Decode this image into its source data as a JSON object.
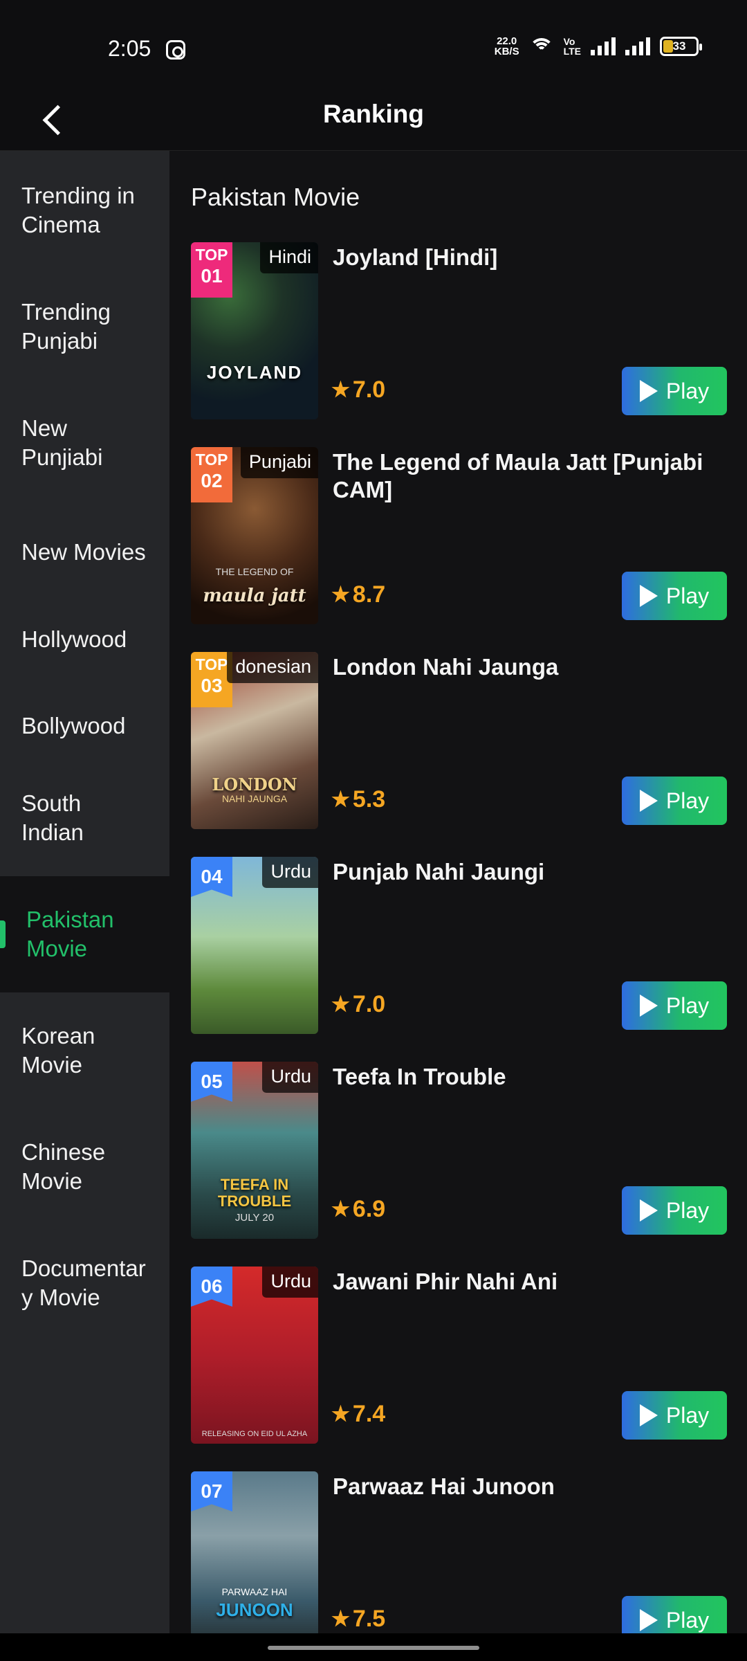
{
  "status_bar": {
    "time": "2:05",
    "net_speed_value": "22.0",
    "net_speed_unit": "KB/S",
    "volte_top": "Vo",
    "volte_bottom": "LTE",
    "battery": "33"
  },
  "header": {
    "title": "Ranking"
  },
  "sidebar": {
    "items": [
      {
        "label": "Trending in Cinema",
        "active": false
      },
      {
        "label": "Trending Punjabi",
        "active": false
      },
      {
        "label": "New Punjiabi",
        "active": false
      },
      {
        "label": "New Movies",
        "active": false
      },
      {
        "label": "Hollywood",
        "active": false
      },
      {
        "label": "Bollywood",
        "active": false
      },
      {
        "label": "South Indian",
        "active": false
      },
      {
        "label": "Pakistan Movie",
        "active": true
      },
      {
        "label": "Korean Movie",
        "active": false
      },
      {
        "label": "Chinese Movie",
        "active": false
      },
      {
        "label": "Documentary Movie",
        "active": false
      }
    ]
  },
  "content": {
    "section_title": "Pakistan Movie",
    "play_label": "Play",
    "movies": [
      {
        "rank_top": "TOP",
        "rank": "01",
        "language": "Hindi",
        "title": "Joyland [Hindi]",
        "rating": "7.0",
        "poster_text": "JOYLAND",
        "poster_sub": ""
      },
      {
        "rank_top": "TOP",
        "rank": "02",
        "language": "Punjabi",
        "title": "The Legend of Maula Jatt [Punjabi CAM]",
        "rating": "8.7",
        "poster_text": "maula jatt",
        "poster_sub": "THE LEGEND OF"
      },
      {
        "rank_top": "TOP",
        "rank": "03",
        "language": "donesian",
        "title": "London Nahi Jaunga",
        "rating": "5.3",
        "poster_text": "LONDON",
        "poster_sub": "NAHI JAUNGA"
      },
      {
        "rank_top": "",
        "rank": "04",
        "language": "Urdu",
        "title": "Punjab Nahi Jaungi",
        "rating": "7.0",
        "poster_text": "",
        "poster_sub": ""
      },
      {
        "rank_top": "",
        "rank": "05",
        "language": "Urdu",
        "title": "Teefa In Trouble",
        "rating": "6.9",
        "poster_text": "TEEFA IN TROUBLE",
        "poster_sub": "JULY 20"
      },
      {
        "rank_top": "",
        "rank": "06",
        "language": "Urdu",
        "title": "Jawani Phir Nahi Ani",
        "rating": "7.4",
        "poster_text": "",
        "poster_sub": "RELEASING ON EID UL AZHA"
      },
      {
        "rank_top": "",
        "rank": "07",
        "language": "",
        "title": "Parwaaz Hai Junoon",
        "rating": "7.5",
        "poster_text": "JUNOON",
        "poster_sub": "PARWAAZ HAI"
      }
    ]
  },
  "colors": {
    "accent": "#22c06a",
    "rating": "#f5a623",
    "sidebar_bg": "#252629",
    "content_bg": "#121214"
  }
}
